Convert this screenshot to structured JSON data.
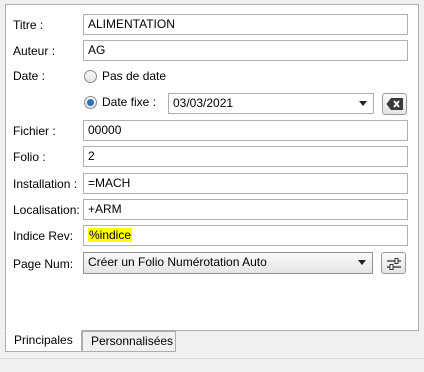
{
  "fields": {
    "titre": {
      "label": "Titre :",
      "value": "ALIMENTATION"
    },
    "auteur": {
      "label": "Auteur :",
      "value": "AG"
    },
    "date": {
      "label": "Date :",
      "option_none": "Pas de date",
      "option_fixed": "Date fixe :",
      "selected": "fixed",
      "value": "03/03/2021"
    },
    "fichier": {
      "label": "Fichier :",
      "value": "00000"
    },
    "folio": {
      "label": "Folio :",
      "value": "2"
    },
    "installation": {
      "label": "Installation :",
      "value": "=MACH"
    },
    "localisation": {
      "label": "Localisation:",
      "value": "+ARM"
    },
    "indice_rev": {
      "label": "Indice Rev:",
      "value": "%indice",
      "highlight_color": "#ffff00"
    },
    "page_num": {
      "label": "Page Num:",
      "value": "Créer un Folio Numérotation Auto"
    }
  },
  "icons": {
    "clear_date": "backspace-clear-icon",
    "page_num_options": "sliders-settings-icon"
  },
  "tabs": [
    {
      "label": "Principales",
      "active": true
    },
    {
      "label": "Personnalisées",
      "active": false
    }
  ],
  "colors": {
    "radio_selected": "#2f6fb4",
    "panel_border": "#adadad"
  }
}
